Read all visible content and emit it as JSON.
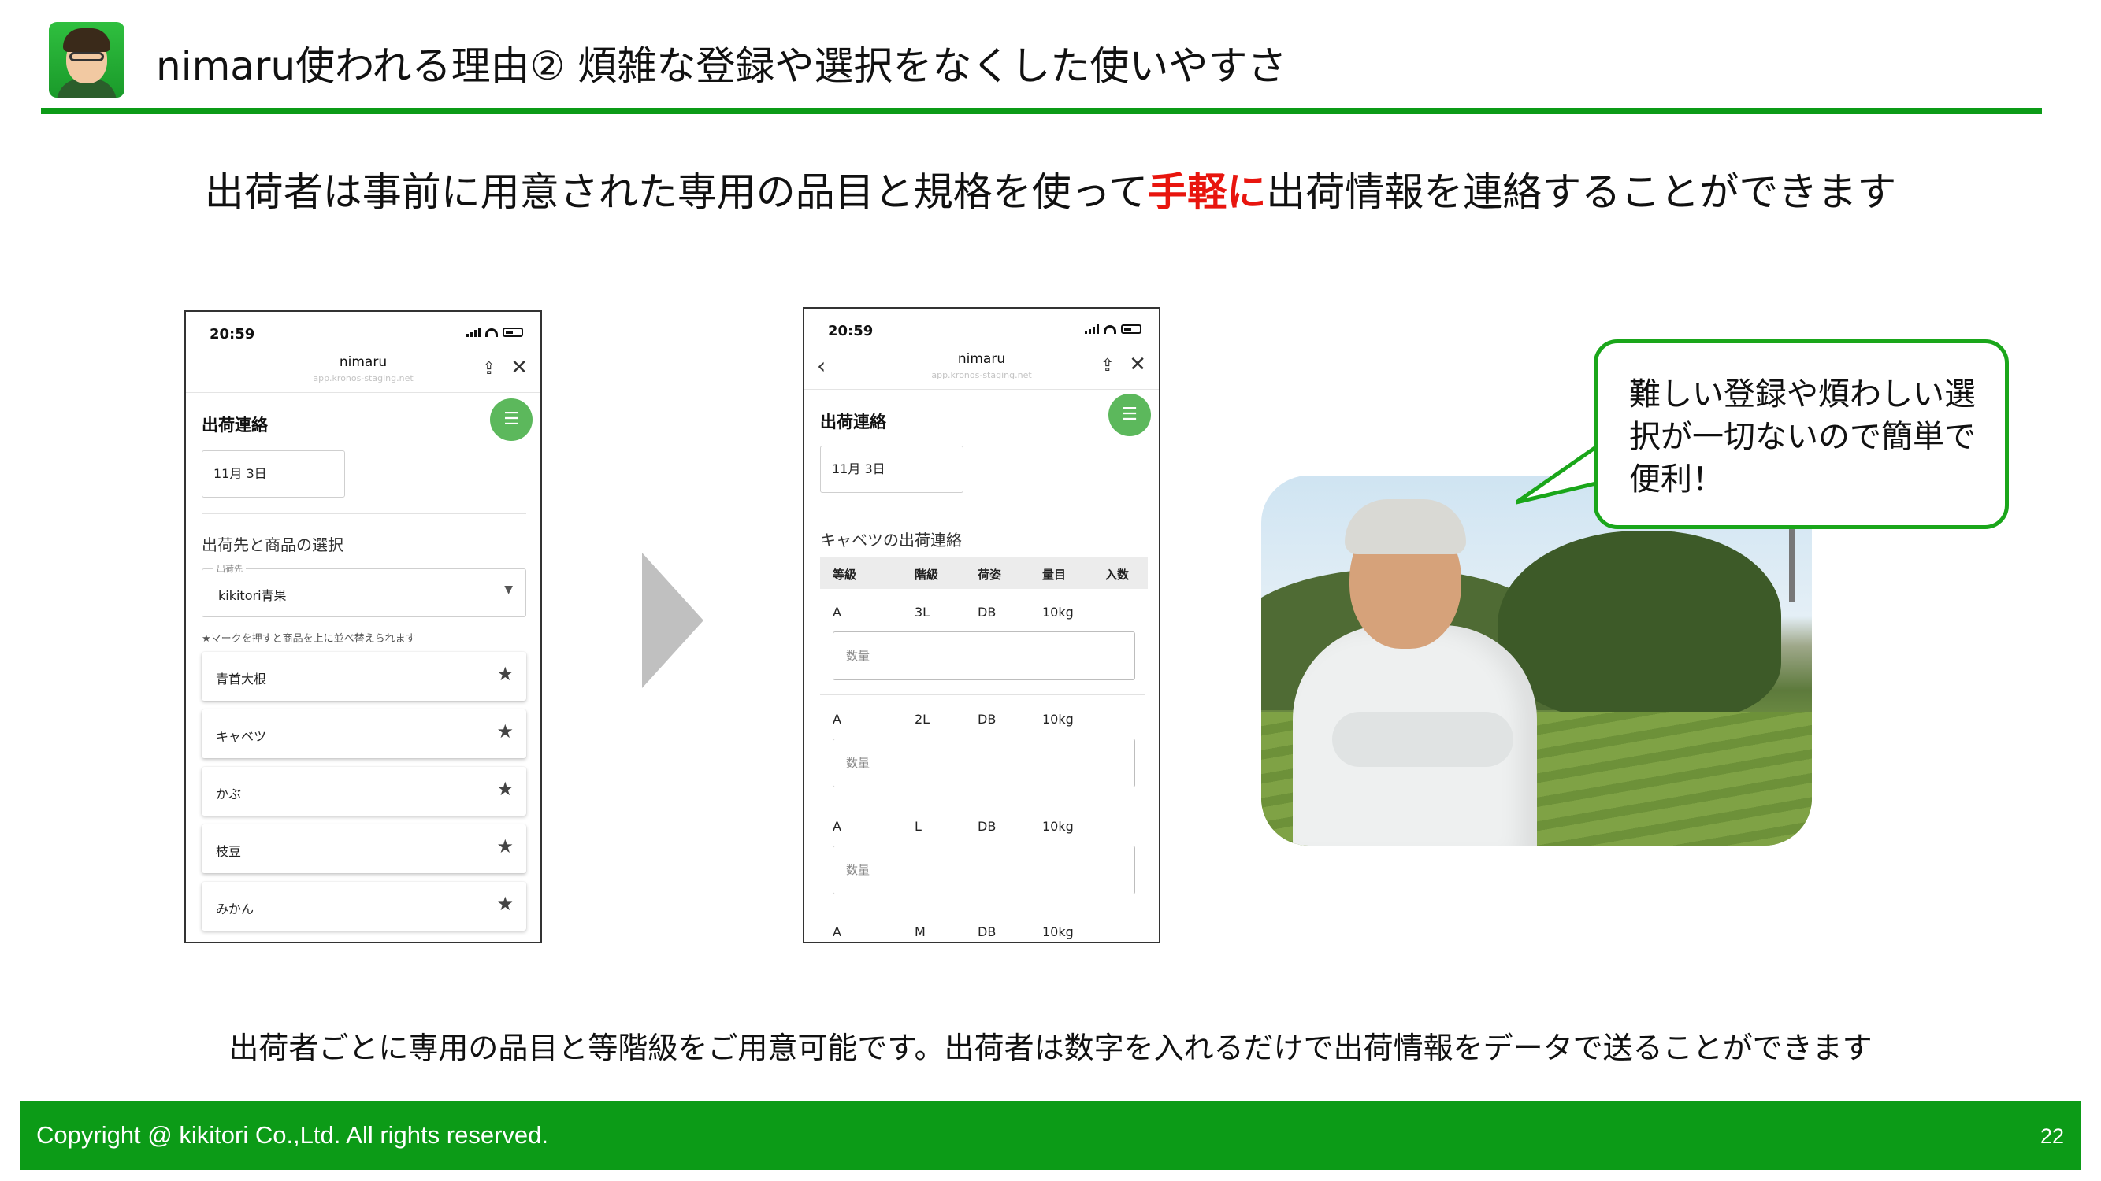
{
  "header": {
    "title": "nimaru使われる理由② 煩雑な登録や選択をなくした使いやすさ",
    "accent_color": "#0c9b17"
  },
  "headline": {
    "before": "出荷者は事前に用意された専用の品目と規格を使って",
    "accent": "手軽に",
    "after": "出荷情報を連絡することができます",
    "accent_color": "#e8150e"
  },
  "phone1": {
    "time": "20:59",
    "app_name": "nimaru",
    "app_url": "app.kronos-staging.net",
    "screen_title": "出荷連絡",
    "date": "11月 3日",
    "section_label": "出荷先と商品の選択",
    "select_legend": "出荷先",
    "select_value": "kikitori青果",
    "hint": "★マークを押すと商品を上に並べ替えられます",
    "items": [
      "青首大根",
      "キャベツ",
      "かぶ",
      "枝豆",
      "みかん"
    ]
  },
  "phone2": {
    "time": "20:59",
    "app_name": "nimaru",
    "app_url": "app.kronos-staging.net",
    "screen_title": "出荷連絡",
    "date": "11月 3日",
    "section_label": "キャベツの出荷連絡",
    "columns": [
      "等級",
      "階級",
      "荷姿",
      "量目",
      "入数"
    ],
    "qty_placeholder": "数量",
    "rows": [
      {
        "grade": "A",
        "size": "3L",
        "pack": "DB",
        "weight": "10kg"
      },
      {
        "grade": "A",
        "size": "2L",
        "pack": "DB",
        "weight": "10kg"
      },
      {
        "grade": "A",
        "size": "L",
        "pack": "DB",
        "weight": "10kg"
      },
      {
        "grade": "A",
        "size": "M",
        "pack": "DB",
        "weight": "10kg"
      }
    ]
  },
  "bubble": {
    "text": "難しい登録や煩わしい選択が一切ないので簡単で便利！"
  },
  "caption": "出荷者ごとに専用の品目と等階級をご用意可能です。出荷者は数字を入れるだけで出荷情報をデータで送ることができます",
  "footer": {
    "copyright": "Copyright @ kikitori Co.,Ltd. All rights reserved.",
    "page": "22"
  }
}
